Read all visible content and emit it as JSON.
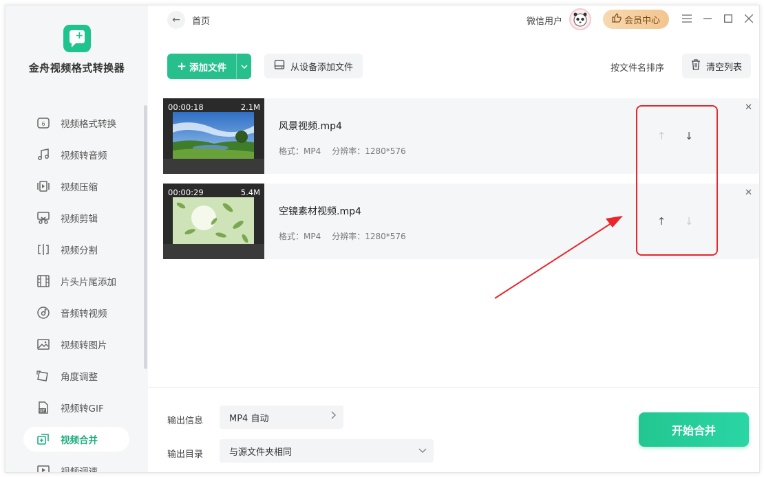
{
  "app": {
    "title": "金舟视频格式转换器"
  },
  "sidebar": {
    "items": [
      {
        "label": "视频格式转换",
        "icon": "video-convert-icon"
      },
      {
        "label": "视频转音频",
        "icon": "music-note-icon"
      },
      {
        "label": "视频压缩",
        "icon": "compress-icon"
      },
      {
        "label": "视频剪辑",
        "icon": "scissors-icon"
      },
      {
        "label": "视频分割",
        "icon": "split-icon"
      },
      {
        "label": "片头片尾添加",
        "icon": "film-strip-icon"
      },
      {
        "label": "音频转视频",
        "icon": "audio-disc-icon"
      },
      {
        "label": "视频转图片",
        "icon": "image-icon"
      },
      {
        "label": "角度调整",
        "icon": "rotate-icon"
      },
      {
        "label": "视频转GIF",
        "icon": "gif-file-icon"
      },
      {
        "label": "视频合并",
        "icon": "merge-icon",
        "active": true
      },
      {
        "label": "视频调速",
        "icon": "speed-icon"
      }
    ]
  },
  "header": {
    "breadcrumb": "首页",
    "user_name": "微信用户",
    "vip_label": "会员中心"
  },
  "toolbar": {
    "add_file": "添加文件",
    "add_from_device": "从设备添加文件",
    "sort_by_name": "按文件名排序",
    "clear_list": "清空列表"
  },
  "files": [
    {
      "duration": "00:00:18",
      "size": "2.1M",
      "name": "风景视频.mp4",
      "format": "格式：MP4",
      "resolution": "分辨率：1280*576",
      "up_enabled": false,
      "down_enabled": true
    },
    {
      "duration": "00:00:29",
      "size": "5.4M",
      "name": "空镜素材视频.mp4",
      "format": "格式：MP4",
      "resolution": "分辨率：1280*576",
      "up_enabled": true,
      "down_enabled": false
    }
  ],
  "footer": {
    "output_info_label": "输出信息",
    "output_info_value": "MP4 自动",
    "output_dir_label": "输出目录",
    "output_dir_value": "与源文件夹相同",
    "start_button": "开始合并"
  },
  "colors": {
    "accent": "#27c08c",
    "annotation": "#e8262b",
    "vip": "#f2c58f"
  }
}
